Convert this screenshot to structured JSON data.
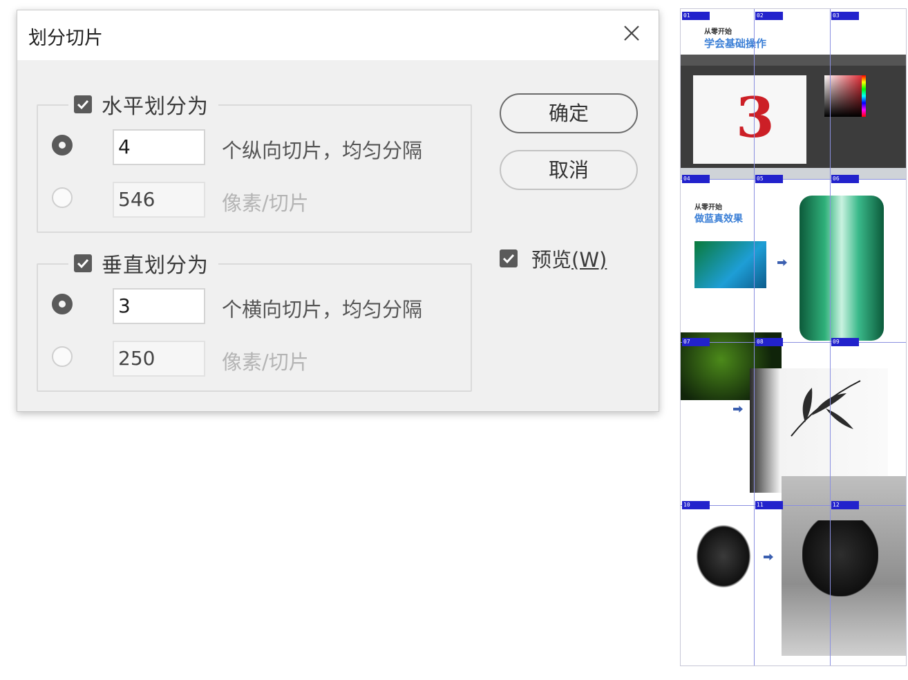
{
  "dialog": {
    "title": "划分切片",
    "horizontal": {
      "label": "水平划分为",
      "checked": true,
      "count_value": "4",
      "count_desc": "个纵向切片，均匀分隔",
      "pixel_value": "546",
      "pixel_desc": "像素/切片",
      "selected": "count"
    },
    "vertical": {
      "label": "垂直划分为",
      "checked": true,
      "count_value": "3",
      "count_desc": "个横向切片，均匀分隔",
      "pixel_value": "250",
      "pixel_desc": "像素/切片",
      "selected": "count"
    },
    "ok_label": "确定",
    "cancel_label": "取消",
    "preview_label": "预览",
    "preview_shortcut": "(W)",
    "preview_checked": true
  },
  "slice_preview": {
    "headline_small": "从零开始",
    "headline_blue": "学会基础操作",
    "screen_digit": "3",
    "headline2_small": "从零开始",
    "headline2_blue": "做蓝真效果",
    "slice_tags": [
      "01",
      "02",
      "03",
      "04",
      "05",
      "06",
      "07",
      "08",
      "09",
      "10",
      "11",
      "12"
    ],
    "accent_color": "#2222cc",
    "digit_color": "#cc1f26"
  }
}
